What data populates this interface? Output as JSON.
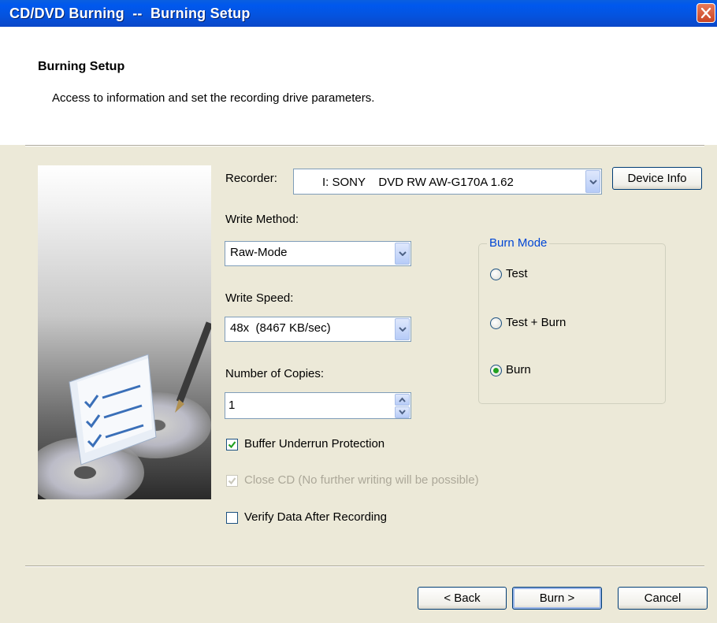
{
  "window": {
    "title": "CD/DVD Burning  --  Burning Setup"
  },
  "header": {
    "title": "Burning Setup",
    "subtitle": "Access to information and set the recording drive parameters."
  },
  "recorder": {
    "label": "Recorder:",
    "value": "I: SONY    DVD RW AW-G170A 1.62",
    "device_info_label": "Device Info"
  },
  "write_method": {
    "label": "Write Method:",
    "value": "Raw-Mode"
  },
  "write_speed": {
    "label": "Write Speed:",
    "value": "48x  (8467 KB/sec)"
  },
  "copies": {
    "label": "Number of Copies:",
    "value": "1"
  },
  "options": {
    "buffer_underrun": {
      "label": "Buffer Underrun Protection",
      "checked": true
    },
    "close_cd": {
      "label": "Close CD (No further writing will be possible)",
      "checked": true,
      "disabled": true
    },
    "verify": {
      "label": "Verify Data After Recording",
      "checked": false
    }
  },
  "burn_mode": {
    "legend": "Burn Mode",
    "options": [
      {
        "label": "Test",
        "selected": false
      },
      {
        "label": "Test + Burn",
        "selected": false
      },
      {
        "label": "Burn",
        "selected": true
      }
    ]
  },
  "footer": {
    "back_label": "< Back",
    "burn_label": "Burn >",
    "cancel_label": "Cancel"
  },
  "colors": {
    "titlebar": "#0058ee",
    "legend": "#0046d5",
    "radio_dot": "#21a121"
  }
}
